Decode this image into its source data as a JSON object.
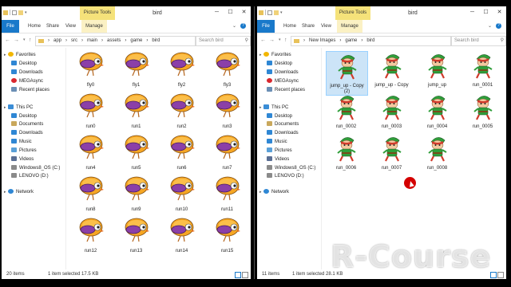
{
  "colors": {
    "accent": "#1979ca",
    "tools_tab": "#f5e27a",
    "selection": "#cce4f7",
    "cursor": "#d40000"
  },
  "left": {
    "title": "bird",
    "tools_tab": "Picture Tools",
    "ribbon": {
      "file": "File",
      "home": "Home",
      "share": "Share",
      "view": "View",
      "manage": "Manage"
    },
    "path": [
      "app",
      "src",
      "main",
      "assets",
      "game",
      "bird"
    ],
    "search_placeholder": "Search bird",
    "nav": [
      {
        "label": "Favorites",
        "icon": "star-icon"
      },
      {
        "label": "Desktop",
        "icon": "desktop-icon"
      },
      {
        "label": "Downloads",
        "icon": "downloads-icon"
      },
      {
        "label": "MEGAsync",
        "icon": "megasync-icon"
      },
      {
        "label": "Recent places",
        "icon": "recent-places-icon"
      },
      {
        "label": "This PC",
        "icon": "computer-icon"
      },
      {
        "label": "Desktop",
        "icon": "desktop-icon"
      },
      {
        "label": "Documents",
        "icon": "documents-icon"
      },
      {
        "label": "Downloads",
        "icon": "downloads-icon"
      },
      {
        "label": "Music",
        "icon": "music-icon"
      },
      {
        "label": "Pictures",
        "icon": "pictures-icon"
      },
      {
        "label": "Videos",
        "icon": "videos-icon"
      },
      {
        "label": "Windows8_OS (C:)",
        "icon": "drive-icon"
      },
      {
        "label": "LENOVO (D:)",
        "icon": "drive-icon"
      },
      {
        "label": "Network",
        "icon": "network-icon"
      }
    ],
    "files": [
      "fly0",
      "fly1",
      "fly2",
      "fly3",
      "run0",
      "run1",
      "run2",
      "run3",
      "run4",
      "run5",
      "run6",
      "run7",
      "run8",
      "run9",
      "run10",
      "run11",
      "run12",
      "run13",
      "run14",
      "run15"
    ],
    "status_count": "20 items",
    "status_selection": "1 item selected 17.5 KB"
  },
  "right": {
    "title": "bird",
    "tools_tab": "Picture Tools",
    "ribbon": {
      "file": "File",
      "home": "Home",
      "share": "Share",
      "view": "View",
      "manage": "Manage"
    },
    "path": [
      "New Images",
      "game",
      "bird"
    ],
    "search_placeholder": "Search bird",
    "nav": [
      {
        "label": "Favorites",
        "icon": "star-icon"
      },
      {
        "label": "Desktop",
        "icon": "desktop-icon"
      },
      {
        "label": "Downloads",
        "icon": "downloads-icon"
      },
      {
        "label": "MEGAsync",
        "icon": "megasync-icon"
      },
      {
        "label": "Recent places",
        "icon": "recent-places-icon"
      },
      {
        "label": "This PC",
        "icon": "computer-icon"
      },
      {
        "label": "Desktop",
        "icon": "desktop-icon"
      },
      {
        "label": "Documents",
        "icon": "documents-icon"
      },
      {
        "label": "Downloads",
        "icon": "downloads-icon"
      },
      {
        "label": "Music",
        "icon": "music-icon"
      },
      {
        "label": "Pictures",
        "icon": "pictures-icon"
      },
      {
        "label": "Videos",
        "icon": "videos-icon"
      },
      {
        "label": "Windows8_OS (C:)",
        "icon": "drive-icon"
      },
      {
        "label": "LENOVO (D:)",
        "icon": "drive-icon"
      },
      {
        "label": "Network",
        "icon": "network-icon"
      }
    ],
    "files": [
      "jump_up - Copy (2)",
      "jump_up - Copy",
      "jump_up",
      "run_0001",
      "run_0002",
      "run_0003",
      "run_0004",
      "run_0005",
      "run_0006",
      "run_0007",
      "run_0008"
    ],
    "selected_index": 0,
    "status_count": "11 items",
    "status_selection": "1 item selected 28.1 KB"
  },
  "watermark": "R-Course"
}
